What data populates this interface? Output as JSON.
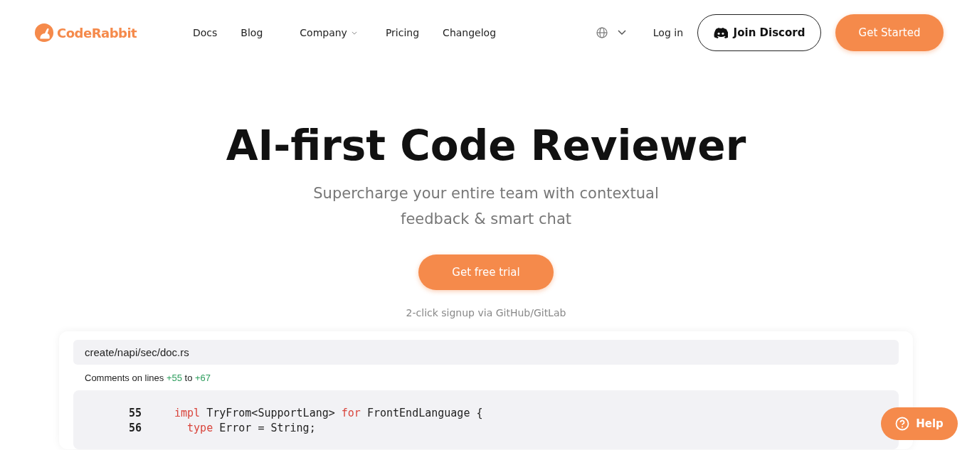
{
  "nav": {
    "brand": "CodeRabbit",
    "links": [
      {
        "label": "Docs",
        "has_menu": false
      },
      {
        "label": "Blog",
        "has_menu": false
      },
      {
        "label": "Company",
        "has_menu": true
      },
      {
        "label": "Pricing",
        "has_menu": false
      },
      {
        "label": "Changelog",
        "has_menu": false
      }
    ],
    "login": "Log in",
    "discord": "Join Discord",
    "cta": "Get Started"
  },
  "hero": {
    "title": "AI-first Code Reviewer",
    "subtitle": "Supercharge your entire team with contextual feedback & smart chat",
    "button": "Get free trial",
    "note": "2-click signup via GitHub/GitLab"
  },
  "review": {
    "file": "create/napi/sec/doc.rs",
    "comment_parts": [
      {
        "text": "Comments on lines ",
        "kind": "plain"
      },
      {
        "text": "+55",
        "kind": "added"
      },
      {
        "text": " to ",
        "kind": "plain"
      },
      {
        "text": "+67",
        "kind": "added"
      }
    ],
    "lines": [
      {
        "number": "55",
        "tokens": [
          {
            "text": "impl",
            "kind": "keyword"
          },
          {
            "text": " TryFrom<SupportLang> ",
            "kind": "plain"
          },
          {
            "text": "for",
            "kind": "keyword"
          },
          {
            "text": " FrontEndLanguage {",
            "kind": "plain"
          }
        ],
        "children": [
          {
            "number": "56",
            "tokens": [
              {
                "text": "type",
                "kind": "keyword"
              },
              {
                "text": " Error = String;",
                "kind": "plain"
              }
            ]
          }
        ]
      }
    ]
  },
  "help": "Help"
}
